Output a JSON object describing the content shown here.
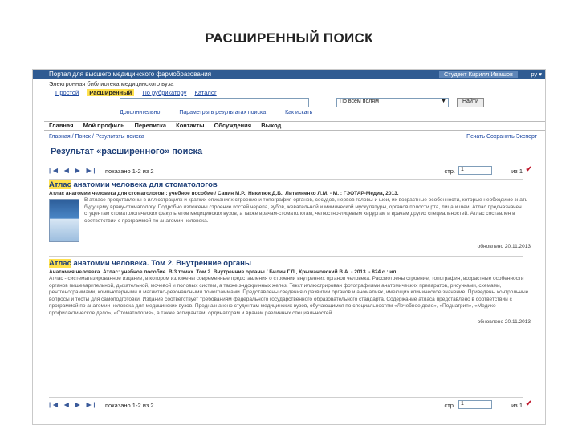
{
  "slide_title": "РАСШИРЕННЫЙ ПОИСК",
  "header": {
    "left": "Портал для высшего медицинского фармобразования",
    "right": "Студент Кирилл Ивашов",
    "lang": "ру ▾"
  },
  "library_line": "Электронная библиотека медицинского вуза",
  "search_tabs": [
    "Простой",
    "Расширенный",
    "По рубрикатору",
    "Каталог"
  ],
  "search_tab_active": 1,
  "search": {
    "query": "",
    "field": "По всем полям",
    "find_button": "Найти"
  },
  "sub_links": [
    "Дополнительно",
    "Параметры в результатах поиска",
    "Как искать"
  ],
  "nav": [
    "Главная",
    "Мой профиль",
    "Переписка",
    "Контакты",
    "Обсуждения",
    "Выход"
  ],
  "breadcrumbs": "Главная / Поиск / Результаты поиска",
  "right_tools": "Печать   Сохранить   Экспорт",
  "results_title": "Результат «расширенного» поиска",
  "pager_top": {
    "shown": "показано 1-2 из 2",
    "page_label": "стр.",
    "page_value": "1",
    "of": "из 1",
    "mark": "✔"
  },
  "pager_bottom": {
    "shown": "показано 1-2 из 2",
    "page_label": "стр.",
    "page_value": "1",
    "of": "из 1",
    "mark": "✔"
  },
  "results": [
    {
      "title_hl": "Атлас",
      "title_rest": " анатомии человека для стоматологов",
      "meta": "Атлас анатомии человека для стоматологов : учебное пособие / Сапин М.Р., Никитюк Д.Б., Литвиненко Л.М. - М. : ГЭОТАР-Медиа, 2013.",
      "snippet": "В атласе представлены в иллюстрациях и кратких описаниях строение и топография органов, сосудов, нервов головы и шеи, их возрастные особенности, которые необходимо знать будущему врачу-стоматологу. Подробно изложены строение костей черепа, зубов, жевательной и мимической мускулатуры, органов полости рта, лица и шеи. Атлас предназначен студентам стоматологических факультетов медицинских вузов, а также врачам-стоматологам, челюстно-лицевым хирургам и врачам других специальностей. Атлас составлен в соответствии с программой по анатомии человека.",
      "date": "обновлено 20.11.2013"
    },
    {
      "title_hl": "Атлас",
      "title_rest": " анатомии человека. Том 2. Внутренние органы",
      "meta": "Анатомия человека. Атлас: учебное пособие. В 3 томах. Том 2. Внутренние органы / Билич Г.Л., Крыжановский В.А. - 2013. - 824 с.: ил.",
      "snippet": "Атлас - систематизированное издание, в котором изложены современные представления о строении внутренних органов человека. Рассмотрены строение, топография, возрастные особенности органов пищеварительной, дыхательной, мочевой и половых систем, а также эндокринных желез. Текст иллюстрирован фотографиями анатомических препаратов, рисунками, схемами, рентгенограммами, компьютерными и магнитно-резонансными томограммами. Представлены сведения о развитии органов и аномалиях, имеющих клиническое значение. Приведены контрольные вопросы и тесты для самоподготовки. Издание соответствует требованиям федерального государственного образовательного стандарта. Содержание атласа представлено в соответствии с программой по анатомии человека для медицинских вузов. Предназначено студентам медицинских вузов, обучающимся по специальностям «Лечебное дело», «Педиатрия», «Медико-профилактическое дело», «Стоматология», а также аспирантам, ординаторам и врачам различных специальностей.",
      "date": "обновлено 20.11.2013"
    }
  ]
}
